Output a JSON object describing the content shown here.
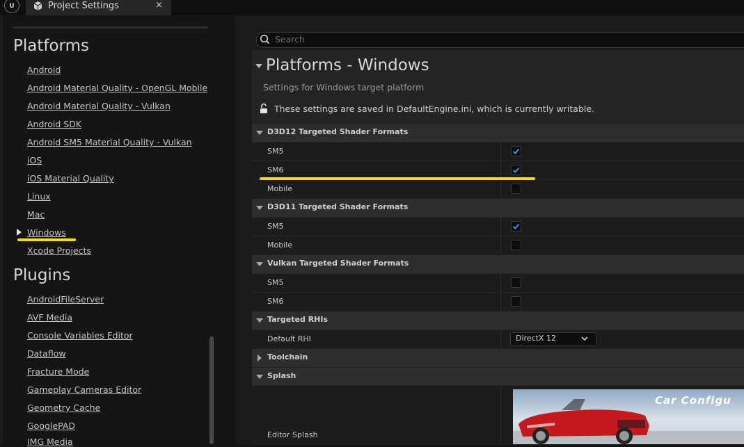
{
  "window": {
    "logo_text": "U",
    "tab_title": "Project Settings",
    "tab_close": "×"
  },
  "sidebar": {
    "sections": [
      {
        "title": "Platforms",
        "items": [
          "Android",
          "Android Material Quality - OpenGL Mobile",
          "Android Material Quality - Vulkan",
          "Android SDK",
          "Android SM5 Material Quality - Vulkan",
          "iOS",
          "iOS Material Quality",
          "Linux",
          "Mac",
          "Windows",
          "Xcode Projects"
        ]
      },
      {
        "title": "Plugins",
        "items": [
          "AndroidFileServer",
          "AVF Media",
          "Console Variables Editor",
          "Dataflow",
          "Fracture Mode",
          "Gameplay Cameras Editor",
          "Geometry Cache",
          "GooglePAD",
          "IMG Media"
        ]
      }
    ],
    "selected_item": "Windows"
  },
  "search": {
    "placeholder": "Search",
    "value": ""
  },
  "page": {
    "title": "Platforms - Windows",
    "description": "Settings for Windows target platform",
    "writable_notice": "These settings are saved in DefaultEngine.ini, which is currently writable."
  },
  "categories": {
    "d3d12": {
      "title": "D3D12 Targeted Shader Formats",
      "rows": [
        {
          "label": "SM5",
          "checked": true
        },
        {
          "label": "SM6",
          "checked": true
        },
        {
          "label": "Mobile",
          "checked": false
        }
      ]
    },
    "d3d11": {
      "title": "D3D11 Targeted Shader Formats",
      "rows": [
        {
          "label": "SM5",
          "checked": true
        },
        {
          "label": "Mobile",
          "checked": false
        }
      ]
    },
    "vulkan": {
      "title": "Vulkan Targeted Shader Formats",
      "rows": [
        {
          "label": "SM5",
          "checked": false
        },
        {
          "label": "SM6",
          "checked": false
        }
      ]
    },
    "rhis": {
      "title": "Targeted RHIs",
      "default_rhi_label": "Default RHI",
      "default_rhi_value": "DirectX 12"
    },
    "toolchain": {
      "title": "Toolchain",
      "expanded": false
    },
    "splash": {
      "title": "Splash",
      "editor_splash_label": "Editor Splash",
      "image_caption": "Car Configu"
    }
  },
  "colors": {
    "highlight": "#f3e000",
    "checkbox_check": "#3b8ef0",
    "panel_bg": "#242424",
    "category_bg": "#2e2e2e"
  }
}
